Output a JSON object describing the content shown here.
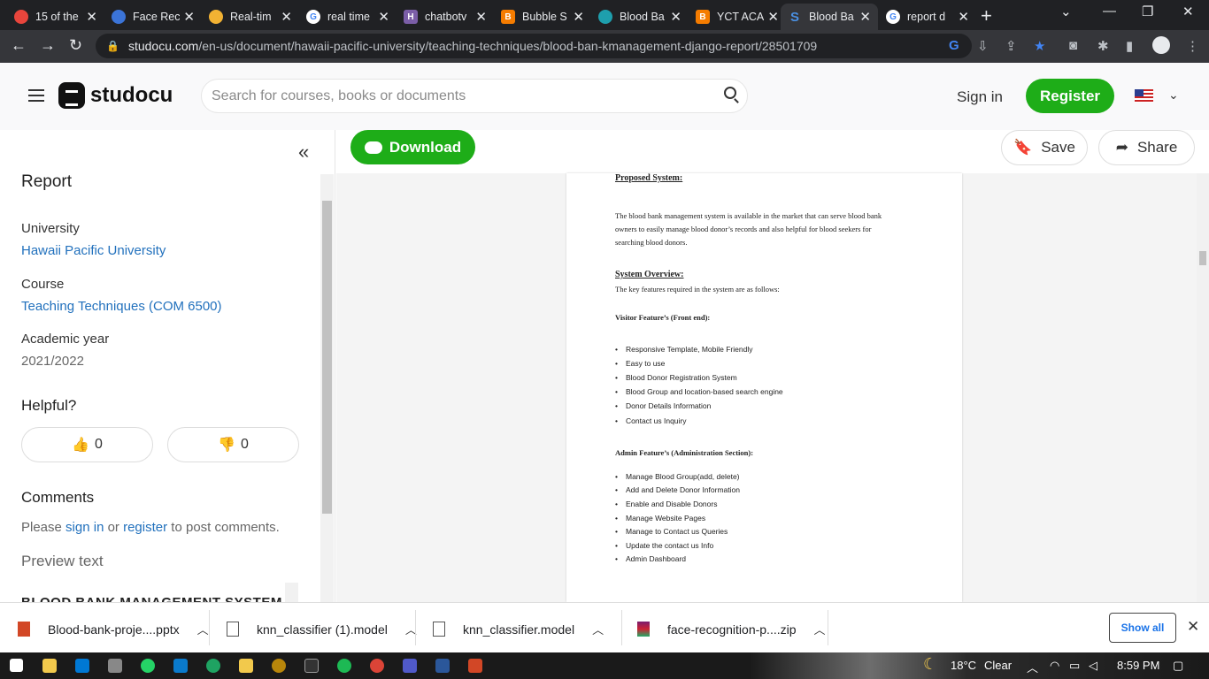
{
  "browser": {
    "tabs": [
      {
        "label": "15 of the",
        "color": "#e8453c",
        "icon": "circle-icon"
      },
      {
        "label": "Face Rec",
        "color": "#3b74d8",
        "icon": "face-icon"
      },
      {
        "label": "Real-tim",
        "color": "#f2b233",
        "icon": "emoji-icon"
      },
      {
        "label": "real time",
        "color": "#4285f4",
        "icon": "google-icon"
      },
      {
        "label": "chatbotv",
        "color": "#7b5ea7",
        "icon": "h-icon"
      },
      {
        "label": "Bubble S",
        "color": "#f57c00",
        "icon": "blogger-icon"
      },
      {
        "label": "Blood Ba",
        "color": "#1e9fad",
        "icon": "globe-icon"
      },
      {
        "label": "YCT ACA",
        "color": "#f57c00",
        "icon": "blogger-icon"
      },
      {
        "label": "Blood Ba",
        "color": "#4285f4",
        "icon": "studocu-icon"
      },
      {
        "label": "report d",
        "color": "#4285f4",
        "icon": "google-icon"
      }
    ],
    "url_domain": "studocu.com",
    "url_path": "/en-us/document/hawaii-pacific-university/teaching-techniques/blood-ban-kmanagement-django-report/28501709"
  },
  "header": {
    "logo": "studocu",
    "search_placeholder": "Search for courses, books or documents",
    "signin": "Sign in",
    "register": "Register"
  },
  "sidebar": {
    "title_partial": "Report",
    "university_label": "University",
    "university": "Hawaii Pacific University",
    "course_label": "Course",
    "course": "Teaching Techniques (COM 6500)",
    "year_label": "Academic year",
    "year": "2021/2022",
    "helpful": "Helpful?",
    "upvotes": "0",
    "downvotes": "0",
    "comments": "Comments",
    "comment_prefix": "Please",
    "comment_signin": "sign in",
    "comment_or": "or",
    "comment_register": "register",
    "comment_suffix": "to post comments.",
    "preview": "Preview text",
    "preview_partial": "BLOOD BANK MANAGEMENT SYSTEM"
  },
  "toolbar": {
    "download": "Download",
    "save": "Save",
    "share": "Share"
  },
  "document": {
    "heading1": "Proposed System:",
    "para1_l1": "The blood bank management system is available in the market that can serve blood bank",
    "para1_l2": "owners to easily manage blood donor’s records and also helpful for blood seekers for",
    "para1_l3": "searching blood donors.",
    "heading2": "System Overview:",
    "para2": "The key features required in the system are as follows:",
    "visitor_heading": "Visitor Feature’s (Front end):",
    "visitor_items": [
      "Responsive Template, Mobile Friendly",
      "Easy to use",
      "Blood Donor Registration System",
      "Blood Group and location-based search engine",
      "Donor Details Information",
      "Contact us Inquiry"
    ],
    "admin_heading": "Admin Feature’s (Administration Section):",
    "admin_items": [
      "Manage Blood Group(add, delete)",
      "Add and Delete Donor Information",
      "Enable and Disable Donors",
      "Manage Website Pages",
      "Manage to Contact us Queries",
      "Update the contact us Info",
      "Admin Dashboard"
    ]
  },
  "downloads": {
    "items": [
      "Blood-bank-proje....pptx",
      "knn_classifier (1).model",
      "knn_classifier.model",
      "face-recognition-p....zip"
    ],
    "show_all": "Show all"
  },
  "taskbar": {
    "weather": "18°C",
    "condition": "Clear",
    "time": "8:59 PM"
  }
}
